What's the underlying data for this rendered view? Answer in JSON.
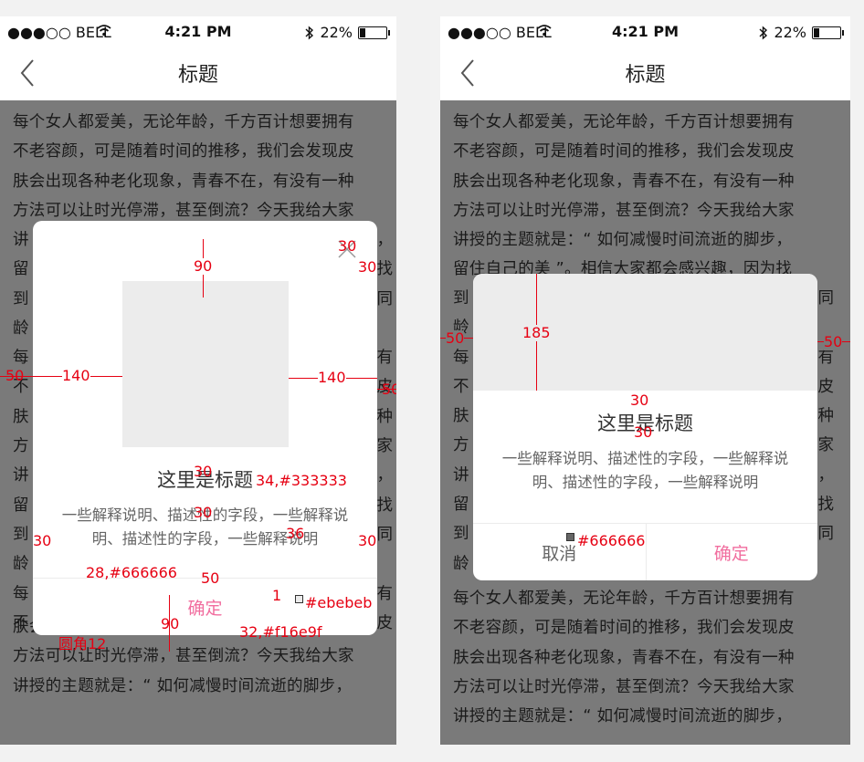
{
  "status_bar": {
    "carrier": "●●●○○ BELL",
    "time": "4:21 PM",
    "battery": "22%",
    "icons": [
      "wifi-icon",
      "bluetooth-icon",
      "battery-icon"
    ]
  },
  "nav": {
    "title": "标题",
    "back_icon": "chevron-left-icon"
  },
  "background_text": [
    "每个女人都爱美，无论年龄，千方百计想要拥有",
    "不老容颜，可是随着时间的推移，我们会发现皮",
    "肤会出现各种老化现象，青春不在，有没有一种",
    "方法可以让时光停滞，甚至倒流？今天我给大家",
    "讲授的主题就是：“ 如何减慢时间流逝的脚步，",
    "留住自己的美 ”。相信大家都会感兴趣，因为找",
    "到",
    "龄",
    "每个女人都爱美，无论年龄，千方百计想要拥有",
    "不老容颜，可是随着时间的推移，我们会发现皮",
    "肤会出现各种老化现象，青春不在，有没有一种",
    "方法可以让时光停滞，甚至倒流？今天我给大家",
    "讲授的主题就是：“ 如何减慢时间流逝的脚步，"
  ],
  "background_edge_left": [
    "讲",
    "留",
    "到",
    "龄",
    "每",
    "不",
    "肤",
    "方",
    "讲",
    "留",
    "到",
    "龄",
    "每",
    "不"
  ],
  "background_edge_right_left_screen": [
    "步，",
    "找",
    "同",
    "",
    "有",
    "皮",
    "种",
    "家",
    "步，",
    "找",
    "同",
    "",
    "有",
    "皮"
  ],
  "dialog_left": {
    "title": "这里是标题",
    "description": "一些解释说明、描述性的字段，一些解释说明、描述性的字段，一些解释说明",
    "confirm_label": "确定",
    "close_icon": "close-icon"
  },
  "dialog_right": {
    "title": "这里是标题",
    "description": "一些解释说明、描述性的字段，一些解释说明、描述性的字段，一些解释说明",
    "cancel_label": "取消",
    "confirm_label": "确定"
  },
  "annotations": {
    "left": {
      "top_gap": "90",
      "close_top": "30",
      "close_right": "30",
      "side_margin_left": "50",
      "side_margin_right": "50",
      "image_side_left": "140",
      "image_side_right": "140",
      "img_to_title": "30",
      "title_spec": "34,#333333",
      "title_to_desc": "30",
      "desc_pad_left": "30",
      "desc_line_height": "36",
      "desc_pad_right": "30",
      "desc_spec": "28,#666666",
      "desc_to_line": "50",
      "divider": "1",
      "divider_color": "#ebebeb",
      "btn_height": "90",
      "btn_spec": "32,#f16e9f",
      "radius": "圆角12"
    },
    "right": {
      "image_height": "185",
      "side_margin_left": "50",
      "side_margin_right": "50",
      "img_to_title": "30",
      "title_to_desc": "30",
      "cancel_color": "#666666"
    }
  },
  "colors": {
    "overlay": "#7a7a7a",
    "title": "#333333",
    "description": "#666666",
    "divider": "#ebebeb",
    "accent": "#f16e9f",
    "annotation": "#e60012"
  }
}
